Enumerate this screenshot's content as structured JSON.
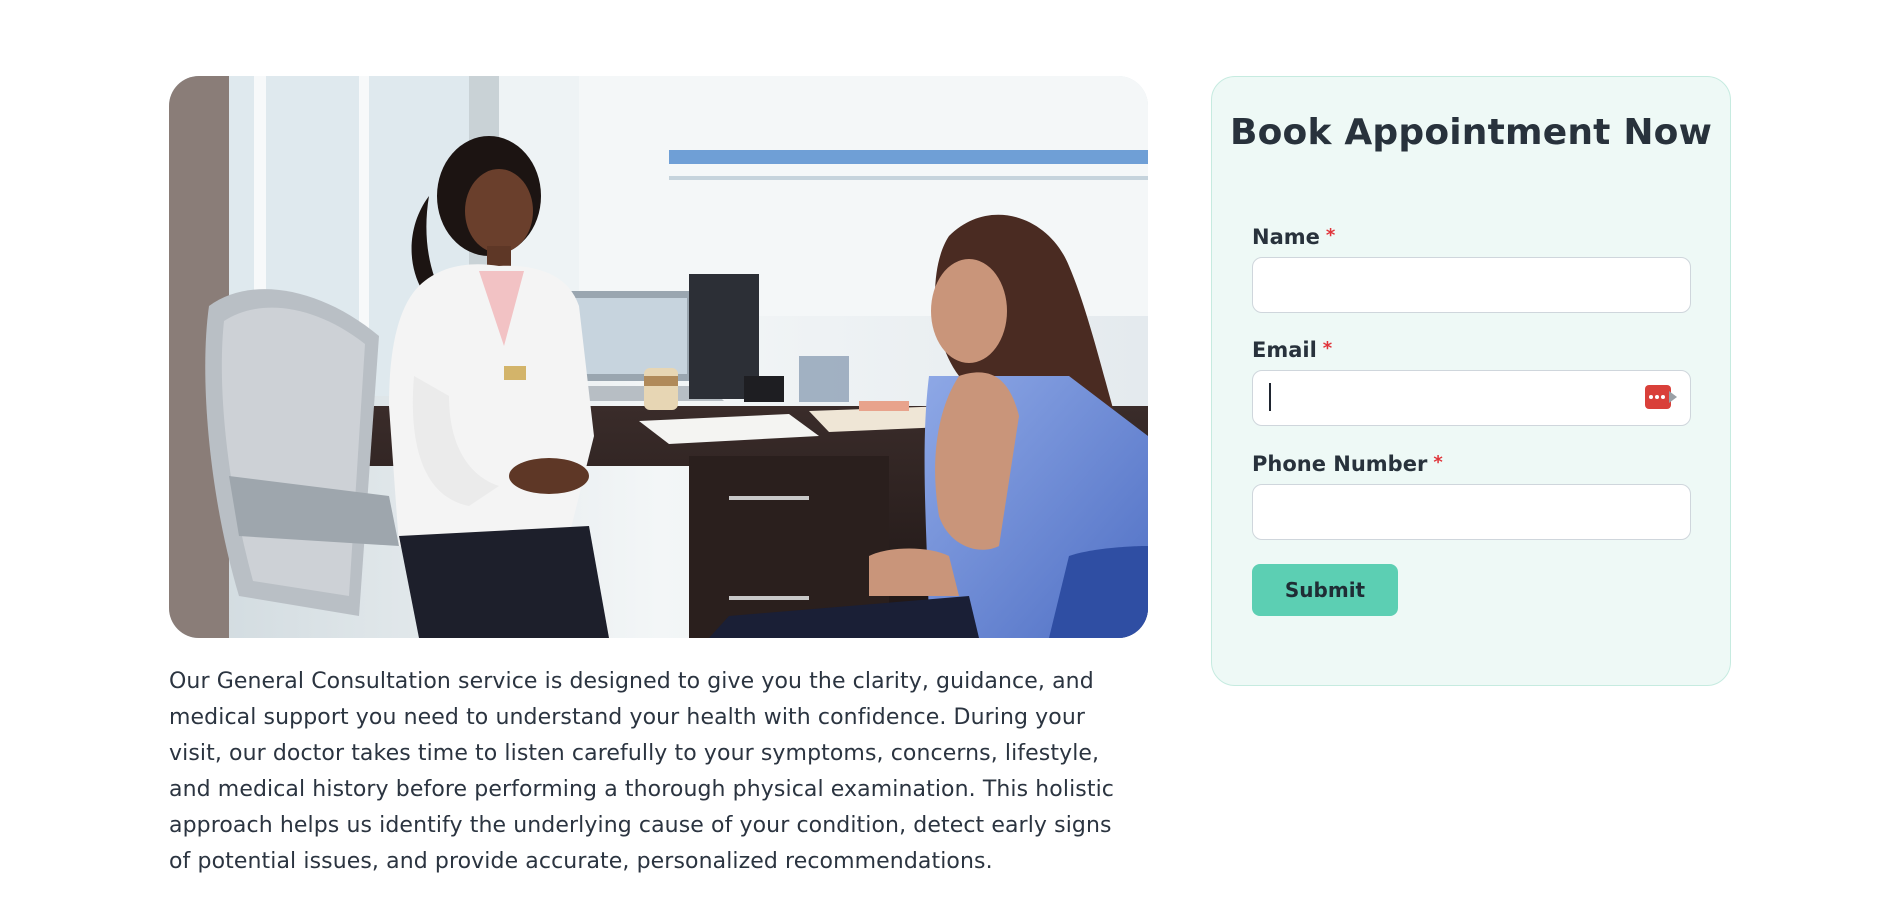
{
  "hero": {
    "image_description": "doctor-consultation-photo"
  },
  "description": {
    "paragraph_1": "Our General Consultation service is designed to give you the clarity, guidance, and medical support you need to understand your health with confidence. During your visit, our doctor takes time to listen carefully to your symptoms, concerns, lifestyle, and medical history before performing a thorough physical examination. This holistic approach helps us identify the underlying cause of your condition, detect early signs of potential issues, and provide accurate, personalized recommendations."
  },
  "booking": {
    "title": "Book Appointment Now",
    "name_label": "Name",
    "email_label": "Email",
    "phone_label": "Phone Number",
    "required_marker": "*",
    "name_value": "",
    "email_value": "",
    "phone_value": "",
    "submit_label": "Submit"
  },
  "colors": {
    "accent": "#5ccfb3",
    "card_bg": "#eef9f6",
    "required": "#e0353b",
    "password_manager_icon": "#d9403a"
  },
  "icons": {
    "email_field_icon": "password-manager-icon"
  }
}
